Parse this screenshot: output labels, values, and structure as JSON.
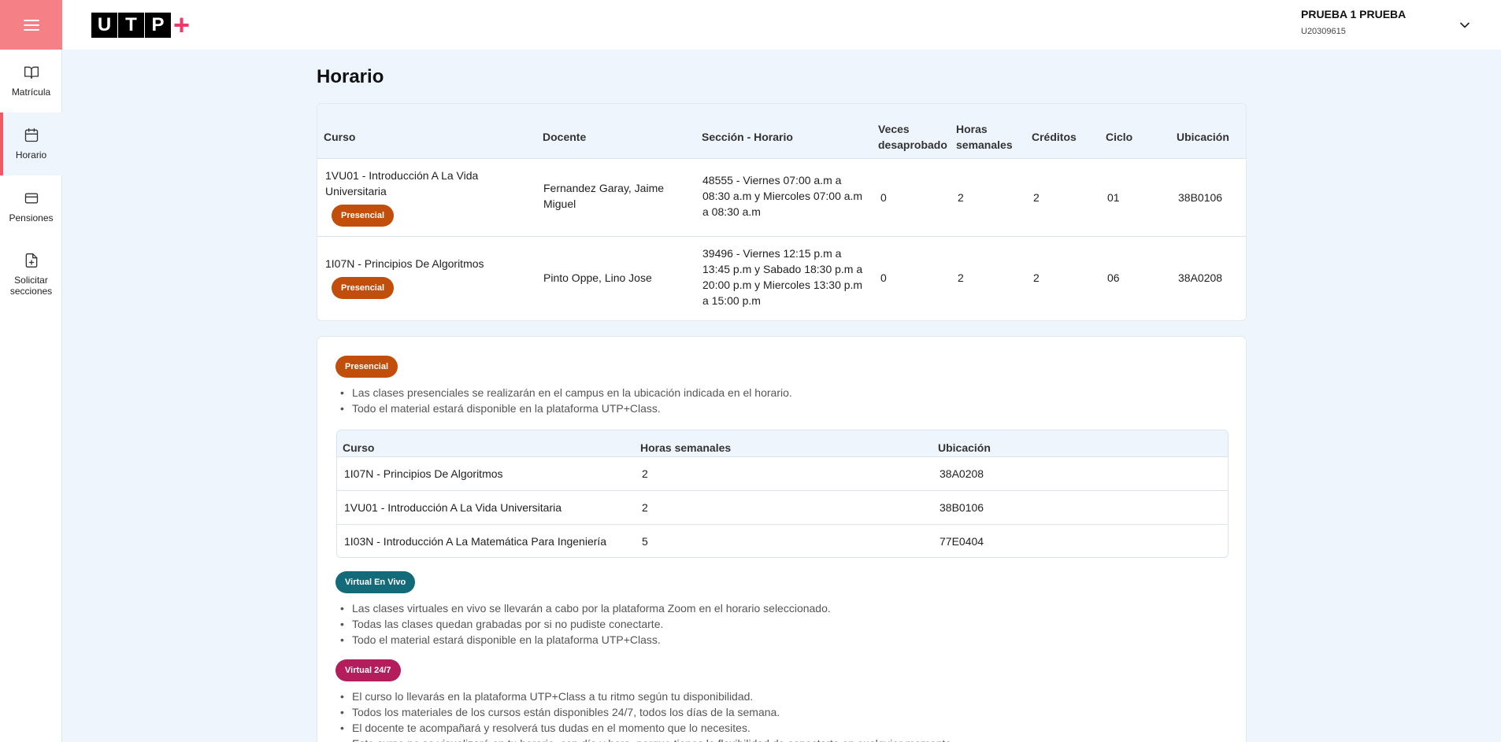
{
  "sidebar": {
    "items": [
      {
        "label": "Matrícula",
        "icon": "book-icon"
      },
      {
        "label": "Horario",
        "icon": "calendar-icon"
      },
      {
        "label": "Pensiones",
        "icon": "credit-card-icon"
      },
      {
        "label": "Solicitar secciones",
        "icon": "file-plus-icon"
      }
    ]
  },
  "header": {
    "logo_letters": [
      "U",
      "T",
      "P"
    ],
    "logo_plus": "+",
    "user_name": "PRUEBA 1 PRUEBA",
    "user_code": "U20309615"
  },
  "page_title": "Horario",
  "schedule_table": {
    "headers": {
      "curso": "Curso",
      "docente": "Docente",
      "seccion": "Sección - Horario",
      "veces": "Veces desaprobado",
      "horas": "Horas semanales",
      "creditos": "Créditos",
      "ciclo": "Ciclo",
      "ubicacion": "Ubicación"
    },
    "rows": [
      {
        "curso": "1VU01 - Introducción A La Vida Universitaria",
        "modalidad": "Presencial",
        "docente": "Fernandez Garay, Jaime Miguel",
        "seccion": "48555 - Viernes 07:00 a.m a 08:30 a.m y Miercoles 07:00 a.m a 08:30 a.m",
        "veces": "0",
        "horas": "2",
        "creditos": "2",
        "ciclo": "01",
        "ubicacion": "38B0106"
      },
      {
        "curso": "1I07N - Principios De Algoritmos",
        "modalidad": "Presencial",
        "docente": "Pinto Oppe, Lino Jose",
        "seccion": "39496 - Viernes 12:15 p.m a 13:45 p.m y Sabado 18:30 p.m a 20:00 p.m y Miercoles 13:30 p.m a 15:00 p.m",
        "veces": "0",
        "horas": "2",
        "creditos": "2",
        "ciclo": "06",
        "ubicacion": "38A0208"
      }
    ]
  },
  "info": {
    "presencial": {
      "chip": "Presencial",
      "bullets": [
        "Las clases presenciales se realizarán en el campus en la ubicación indicada en el horario.",
        "Todo el material estará disponible en la plataforma UTP+Class."
      ],
      "table": {
        "headers": {
          "curso": "Curso",
          "horas": "Horas semanales",
          "ubicacion": "Ubicación"
        },
        "rows": [
          {
            "curso": "1I07N - Principios De Algoritmos",
            "horas": "2",
            "ubicacion": "38A0208"
          },
          {
            "curso": "1VU01 - Introducción A La Vida Universitaria",
            "horas": "2",
            "ubicacion": "38B0106"
          },
          {
            "curso": "1I03N - Introducción A La Matemática Para Ingeniería",
            "horas": "5",
            "ubicacion": "77E0404"
          }
        ]
      }
    },
    "vivo": {
      "chip": "Virtual En Vivo",
      "bullets": [
        "Las clases virtuales en vivo se llevarán a cabo por la plataforma Zoom en el horario seleccionado.",
        "Todas las clases quedan grabadas por si no pudiste conectarte.",
        "Todo el material estará disponible en la plataforma UTP+Class."
      ]
    },
    "v247": {
      "chip": "Virtual 24/7",
      "bullets": [
        "El curso lo llevarás en la plataforma UTP+Class a tu ritmo según tu disponibilidad.",
        "Todos los materiales de los cursos están disponibles 24/7, todos los días de la semana.",
        "El docente te acompañará y resolverá tus dudas en el momento que lo necesites.",
        "Este curso no se visualizará en tu horario, con día y hora, porque tienes la flexibilidad de conectarte en cualquier momento."
      ]
    }
  },
  "colors": {
    "accent": "#f05a64",
    "menu_bg": "#f58187",
    "presencial": "#c24e0c",
    "virtual_en_vivo": "#136b7a",
    "virtual_247": "#b31d5c"
  }
}
